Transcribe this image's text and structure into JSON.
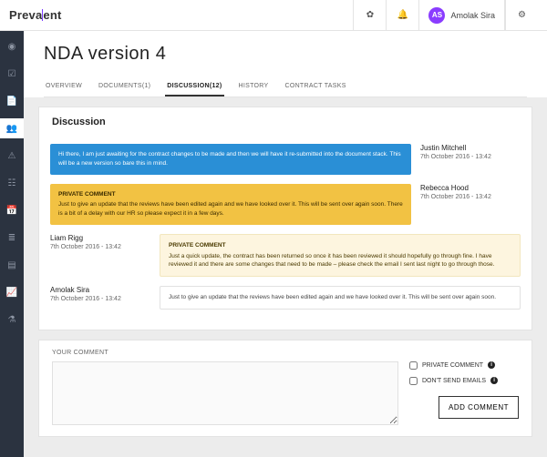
{
  "brand": {
    "name_pre": "Preva",
    "name_post": "ent"
  },
  "user": {
    "initials": "AS",
    "name": "Amolak Sira"
  },
  "sidebar": {
    "items": [
      {
        "icon": "◉"
      },
      {
        "icon": "☑"
      },
      {
        "icon": "📄"
      },
      {
        "icon": "👥"
      },
      {
        "icon": "⚠"
      },
      {
        "icon": "☷"
      },
      {
        "icon": "📅"
      },
      {
        "icon": "≣"
      },
      {
        "icon": "▤"
      },
      {
        "icon": "📈"
      },
      {
        "icon": "⚗"
      }
    ],
    "active_index": 3
  },
  "page": {
    "title": "NDA version 4"
  },
  "tabs": {
    "items": [
      "OVERVIEW",
      "DOCUMENTS(1)",
      "DISCUSSION(12)",
      "HISTORY",
      "CONTRACT TASKS"
    ],
    "active_index": 2
  },
  "discussion": {
    "heading": "Discussion",
    "messages": [
      {
        "side": "right",
        "style": "blue",
        "private": false,
        "author": "Justin Mitchell",
        "time": "7th October 2016 - 13:42",
        "text": "Hi there, I am just awaiting for the contract changes to be made and then we will have it re-submitted into the document stack. This will be a new version so bare this in mind."
      },
      {
        "side": "right",
        "style": "gold",
        "private": true,
        "author": "Rebecca Hood",
        "time": "7th October 2016 - 13:42",
        "text": "Just to give an update that the reviews have been edited again and we have looked over it. This will be sent over again soon. There is a bit of a delay with our HR so please expect it in a few days."
      },
      {
        "side": "left",
        "style": "cream",
        "private": true,
        "author": "Liam Rigg",
        "time": "7th October 2016 - 13:42",
        "text": "Just a quick update, the contract has been returned so once it has been reviewed it should hopefully go through fine. I have reviewed it and there are some changes that need to be made – please check the email I sent last night to go through those."
      },
      {
        "side": "left",
        "style": "plain",
        "private": false,
        "author": "Amolak Sira",
        "time": "7th October 2016 - 13:42",
        "text": "Just to give an update that the reviews have been edited again and we have looked over it. This will be sent over again soon."
      }
    ],
    "private_label": "PRIVATE COMMENT"
  },
  "comment_form": {
    "label": "YOUR COMMENT",
    "opt_private": "PRIVATE COMMENT",
    "opt_noemail": "DON'T SEND EMAILS",
    "submit": "ADD COMMENT"
  }
}
